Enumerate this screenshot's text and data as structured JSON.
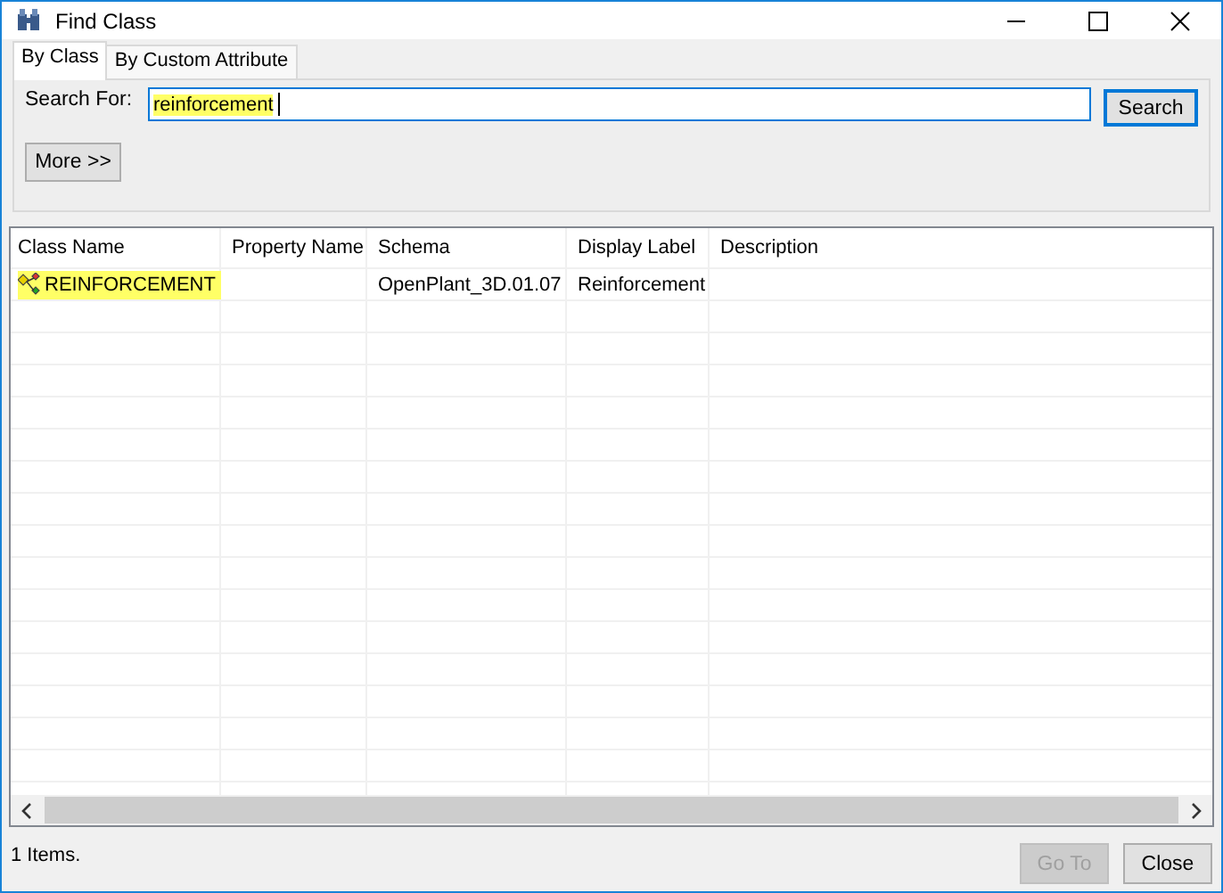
{
  "window": {
    "title": "Find Class"
  },
  "tabs": [
    {
      "label": "By Class",
      "selected": true
    },
    {
      "label": "By Custom Attribute",
      "selected": false
    }
  ],
  "search": {
    "label": "Search For:",
    "value": "reinforcement",
    "highlighted": true,
    "button": "Search"
  },
  "more_button": "More >>",
  "table": {
    "columns": [
      "Class Name",
      "Property Name",
      "Schema",
      "Display Label",
      "Description"
    ],
    "rows": [
      {
        "cells": [
          "REINFORCEMENT",
          "",
          "OpenPlant_3D.01.07",
          "Reinforcement",
          ""
        ],
        "highlighted": true
      }
    ]
  },
  "status_bar": {
    "text": "1 Items."
  },
  "buttons": [
    {
      "label": "Go To",
      "disabled": true
    },
    {
      "label": "Close",
      "disabled": false
    }
  ]
}
